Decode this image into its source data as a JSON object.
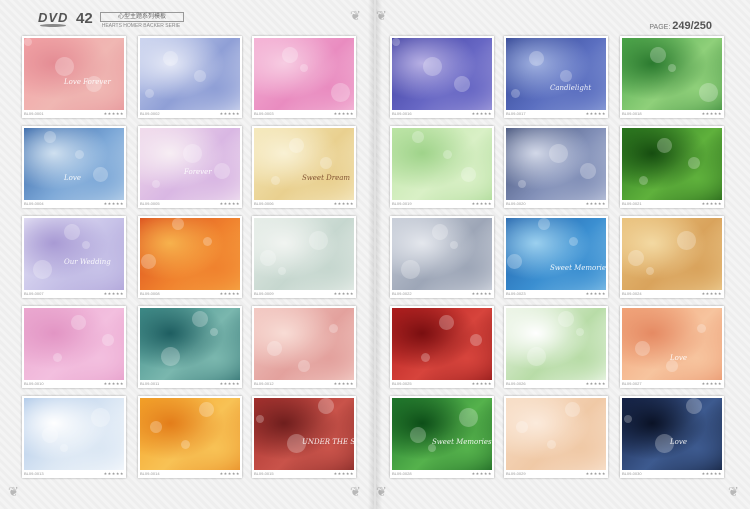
{
  "header": {
    "dvd_label": "DVD",
    "page_number": "42",
    "series_title": "心型主题系列模板",
    "series_subtitle": "HEARTS HOMER BACKER SERIE",
    "page_count_label": "PAGE:",
    "page_count_value": "249/250"
  },
  "left_page": {
    "cells": [
      {
        "code": "BL09-0001",
        "rating": "★★★★★",
        "colors": [
          "#f4a3a6",
          "#f0b7b3",
          "#e48c94"
        ],
        "overlay": "Love Forever"
      },
      {
        "code": "BL09-0002",
        "rating": "★★★★★",
        "colors": [
          "#c9d2ee",
          "#8f9fd6",
          "#e4e8f6"
        ],
        "overlay": ""
      },
      {
        "code": "BL09-0003",
        "rating": "★★★★★",
        "colors": [
          "#f4b0d4",
          "#e98cc0",
          "#f7cce2"
        ],
        "overlay": ""
      },
      {
        "code": "BL09-0004",
        "rating": "★★★★★",
        "colors": [
          "#2d5fa3",
          "#7ea9d8",
          "#cfe0f0"
        ],
        "overlay": "Love"
      },
      {
        "code": "BL09-0005",
        "rating": "★★★★★",
        "colors": [
          "#f0d8ea",
          "#d9b7e3",
          "#f7eef4"
        ],
        "overlay": "Forever"
      },
      {
        "code": "BL09-0006",
        "rating": "★★★★★",
        "colors": [
          "#f4e7b8",
          "#e9d08f",
          "#f9f1d4"
        ],
        "overlay": "Sweet Dream"
      },
      {
        "code": "BL09-0007",
        "rating": "★★★★★",
        "colors": [
          "#e8e6f6",
          "#c7c2e8",
          "#a89ad4"
        ],
        "overlay": "Our Wedding"
      },
      {
        "code": "BL09-0008",
        "rating": "★★★★★",
        "colors": [
          "#d9481a",
          "#f0822e",
          "#f7b24d"
        ],
        "overlay": ""
      },
      {
        "code": "BL09-0009",
        "rating": "★★★★★",
        "colors": [
          "#e4ece6",
          "#c6d7cf",
          "#f1f4f1"
        ],
        "overlay": ""
      },
      {
        "code": "BL09-0010",
        "rating": "★★★★★",
        "colors": [
          "#eba9d0",
          "#f3bfdf",
          "#e295c4"
        ],
        "overlay": ""
      },
      {
        "code": "BL09-0011",
        "rating": "★★★★★",
        "colors": [
          "#3f8e8a",
          "#7ab7ae",
          "#1e5e61"
        ],
        "overlay": ""
      },
      {
        "code": "BL09-0012",
        "rating": "★★★★★",
        "colors": [
          "#f2c6c0",
          "#e3a19d",
          "#f8dcd5"
        ],
        "overlay": ""
      },
      {
        "code": "BL09-0013",
        "rating": "★★★★★",
        "colors": [
          "#a8c4e6",
          "#dbe7f4",
          "#ffffff"
        ],
        "overlay": ""
      },
      {
        "code": "BL09-0014",
        "rating": "★★★★★",
        "colors": [
          "#f5a428",
          "#f8c255",
          "#e37d1a"
        ],
        "overlay": ""
      },
      {
        "code": "BL09-0015",
        "rating": "★★★★★",
        "colors": [
          "#a9312e",
          "#c9534a",
          "#6f1e1d"
        ],
        "overlay": "UNDER THE SUN"
      }
    ]
  },
  "right_page": {
    "cells": [
      {
        "code": "BL09-0016",
        "rating": "★★★★★",
        "colors": [
          "#3b3b9e",
          "#6767c4",
          "#b7b0e4"
        ],
        "overlay": ""
      },
      {
        "code": "BL09-0017",
        "rating": "★★★★★",
        "colors": [
          "#2c3f8f",
          "#5b6fc0",
          "#9fb0e0"
        ],
        "overlay": "Candlelight"
      },
      {
        "code": "BL09-0018",
        "rating": "★★★★★",
        "colors": [
          "#4ca84a",
          "#8fd07a",
          "#2b7a2f"
        ],
        "overlay": ""
      },
      {
        "code": "BL09-0019",
        "rating": "★★★★★",
        "colors": [
          "#bfe6a8",
          "#d9f0c6",
          "#9fd38a"
        ],
        "overlay": ""
      },
      {
        "code": "BL09-0020",
        "rating": "★★★★★",
        "colors": [
          "#3c4a73",
          "#8290b8",
          "#d2d8e8"
        ],
        "overlay": ""
      },
      {
        "code": "BL09-0021",
        "rating": "★★★★★",
        "colors": [
          "#2b7a1f",
          "#5fb13c",
          "#164d10"
        ],
        "overlay": ""
      },
      {
        "code": "BL09-0022",
        "rating": "★★★★★",
        "colors": [
          "#c5cbd6",
          "#9da6b7",
          "#e4e7ed"
        ],
        "overlay": ""
      },
      {
        "code": "BL09-0023",
        "rating": "★★★★★",
        "colors": [
          "#1f5fa8",
          "#3b8fd1",
          "#9bd0ef"
        ],
        "overlay": "Sweet Memories"
      },
      {
        "code": "BL09-0024",
        "rating": "★★★★★",
        "colors": [
          "#e9c07a",
          "#d9a35c",
          "#f3d9a2"
        ],
        "overlay": ""
      },
      {
        "code": "BL09-0025",
        "rating": "★★★★★",
        "colors": [
          "#b51e1e",
          "#d7443c",
          "#7a0e10"
        ],
        "overlay": ""
      },
      {
        "code": "BL09-0026",
        "rating": "★★★★★",
        "colors": [
          "#eaf3e4",
          "#b8dca7",
          "#ffffff"
        ],
        "overlay": ""
      },
      {
        "code": "BL09-0027",
        "rating": "★★★★★",
        "colors": [
          "#f2a57a",
          "#f7c49e",
          "#e58a63"
        ],
        "overlay": "Love"
      },
      {
        "code": "BL09-0028",
        "rating": "★★★★★",
        "colors": [
          "#1f7a2d",
          "#55b24c",
          "#0d4e18"
        ],
        "overlay": "Sweet Memories"
      },
      {
        "code": "BL09-0029",
        "rating": "★★★★★",
        "colors": [
          "#f6dcc4",
          "#f0c9a6",
          "#fbeadb"
        ],
        "overlay": ""
      },
      {
        "code": "BL09-0030",
        "rating": "★★★★★",
        "colors": [
          "#16244a",
          "#3d5a8f",
          "#0a1226"
        ],
        "overlay": "Love"
      }
    ]
  }
}
